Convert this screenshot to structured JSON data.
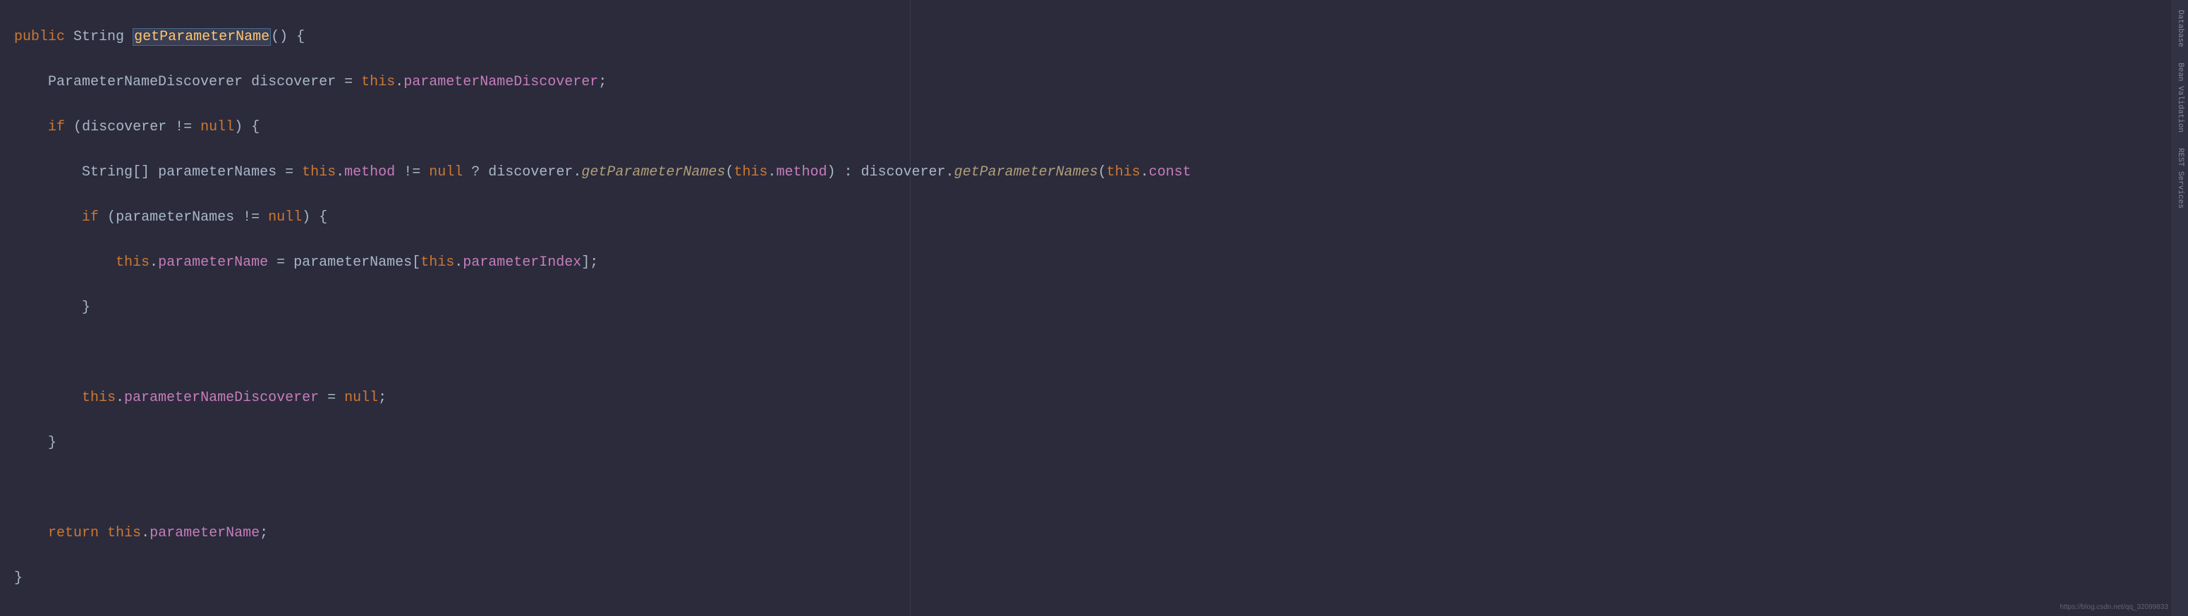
{
  "code": {
    "l1": {
      "public": "public",
      "string": "String",
      "methodName": "getParameterName",
      "parens": "()",
      "brace": "{"
    },
    "l2": {
      "type": "ParameterNameDiscoverer",
      "var": "discoverer",
      "eq": "=",
      "this": "this",
      "dot": ".",
      "field": "parameterNameDiscoverer",
      "semi": ";"
    },
    "l3": {
      "if": "if",
      "open": "(",
      "var": "discoverer",
      "neq": "!=",
      "null": "null",
      "close": ")",
      "brace": "{"
    },
    "l4": {
      "type": "String",
      "brackets": "[]",
      "var": "parameterNames",
      "eq": "=",
      "this1": "this",
      "dot": ".",
      "field1": "method",
      "neq": "!=",
      "null1": "null",
      "q": "?",
      "disc1": "discoverer",
      "call1": "getParameterNames",
      "open1": "(",
      "this2": "this",
      "field2": "method",
      "close1": ")",
      "colon": ":",
      "disc2": "discoverer",
      "call2": "getParameterNames",
      "open2": "(",
      "this3": "this",
      "field3": "const",
      "close2": ""
    },
    "l5": {
      "if": "if",
      "open": "(",
      "var": "parameterNames",
      "neq": "!=",
      "null": "null",
      "close": ")",
      "brace": "{"
    },
    "l6": {
      "this": "this",
      "dot": ".",
      "field": "parameterName",
      "eq": "=",
      "var": "parameterNames",
      "open": "[",
      "this2": "this",
      "field2": "parameterIndex",
      "close": "]",
      "semi": ";"
    },
    "l7": {
      "brace": "}"
    },
    "l8": {},
    "l9": {
      "this": "this",
      "dot": ".",
      "field": "parameterNameDiscoverer",
      "eq": "=",
      "null": "null",
      "semi": ";"
    },
    "l10": {
      "brace": "}"
    },
    "l11": {},
    "l12": {
      "return": "return",
      "this": "this",
      "dot": ".",
      "field": "parameterName",
      "semi": ";"
    },
    "l13": {
      "brace": "}"
    }
  },
  "tabs": {
    "t1": "Database",
    "t2": "Bean Validation",
    "t3": "REST Services"
  },
  "watermark": "https://blog.csdn.net/qq_32099833"
}
